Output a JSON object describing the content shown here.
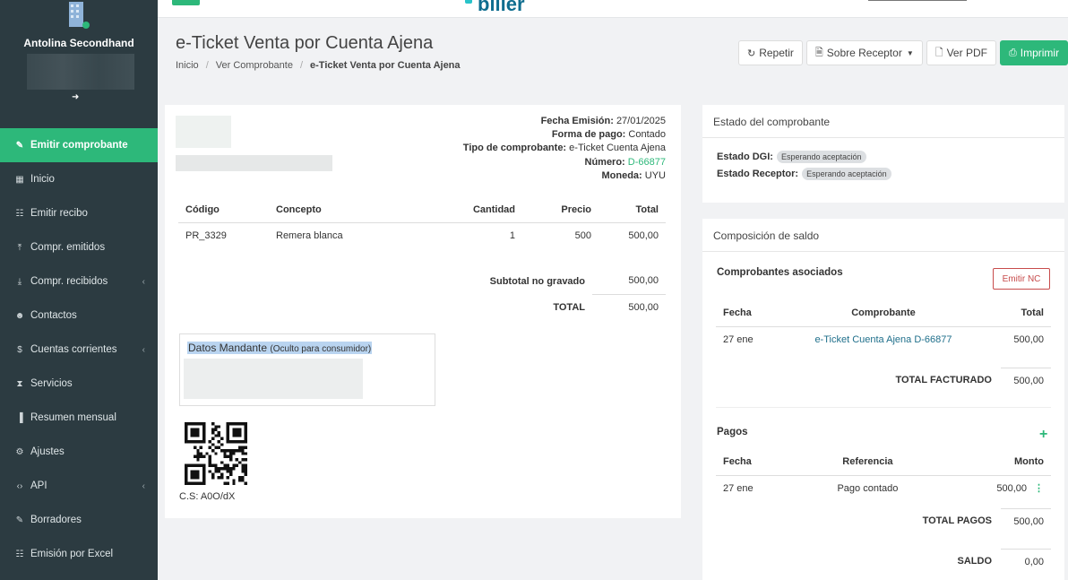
{
  "sidebar": {
    "company": "Antolina Secondhand",
    "items": [
      {
        "label": "Emitir comprobante",
        "icon": "edit-icon"
      },
      {
        "label": "Inicio",
        "icon": "dashboard-icon"
      },
      {
        "label": "Emitir recibo",
        "icon": "document-icon"
      },
      {
        "label": "Compr. emitidos",
        "icon": "upload-icon"
      },
      {
        "label": "Compr. recibidos",
        "icon": "download-icon"
      },
      {
        "label": "Contactos",
        "icon": "users-icon"
      },
      {
        "label": "Cuentas corrientes",
        "icon": "dollar-icon"
      },
      {
        "label": "Servicios",
        "icon": "hourglass-icon"
      },
      {
        "label": "Resumen mensual",
        "icon": "bar-chart-icon"
      },
      {
        "label": "Ajustes",
        "icon": "gears-icon"
      },
      {
        "label": "API",
        "icon": "code-icon"
      },
      {
        "label": "Borradores",
        "icon": "pencil-icon"
      },
      {
        "label": "Emisión por Excel",
        "icon": "document-icon"
      }
    ]
  },
  "topbar": {
    "logo": "biller"
  },
  "header": {
    "title": "e-Ticket Venta por Cuenta Ajena",
    "breadcrumb": [
      "Inicio",
      "Ver Comprobante",
      "e-Ticket Venta por Cuenta Ajena"
    ],
    "buttons": {
      "repetir": "Repetir",
      "receptor": "Sobre Receptor",
      "pdf": "Ver PDF",
      "imprimir": "Imprimir"
    }
  },
  "invoice": {
    "meta": [
      {
        "label": "Fecha Emisión:",
        "value": "27/01/2025"
      },
      {
        "label": "Forma de pago:",
        "value": "Contado"
      },
      {
        "label": "Tipo de comprobante:",
        "value": "e-Ticket Cuenta Ajena"
      },
      {
        "label": "Número:",
        "value": "D-66877"
      },
      {
        "label": "Moneda:",
        "value": "UYU"
      }
    ],
    "columns": [
      "Código",
      "Concepto",
      "Cantidad",
      "Precio",
      "Total"
    ],
    "rows": [
      {
        "codigo": "PR_3329",
        "concepto": "Remera blanca",
        "cantidad": "1",
        "precio": "500",
        "total": "500,00"
      }
    ],
    "subtotal_label": "Subtotal no gravado",
    "subtotal_value": "500,00",
    "total_label": "TOTAL",
    "total_value": "500,00",
    "mandante_title": "Datos Mandante",
    "mandante_note": "(Oculto para consumidor)",
    "cs": "C.S: A0O/dX"
  },
  "estado": {
    "title": "Estado del comprobante",
    "dgi_label": "Estado DGI:",
    "dgi_value": "Esperando aceptación",
    "receptor_label": "Estado Receptor:",
    "receptor_value": "Esperando aceptación"
  },
  "saldo": {
    "title": "Composición de saldo",
    "asociados_title": "Comprobantes asociados",
    "emitir_nc": "Emitir NC",
    "asociados_columns": [
      "Fecha",
      "Comprobante",
      "Total"
    ],
    "asociados_rows": [
      {
        "fecha": "27 ene",
        "comprobante": "e-Ticket Cuenta Ajena D-66877",
        "total": "500,00"
      }
    ],
    "total_facturado_label": "TOTAL FACTURADO",
    "total_facturado_value": "500,00",
    "pagos_title": "Pagos",
    "pagos_columns": [
      "Fecha",
      "Referencia",
      "Monto"
    ],
    "pagos_rows": [
      {
        "fecha": "27 ene",
        "referencia": "Pago contado",
        "monto": "500,00"
      }
    ],
    "total_pagos_label": "TOTAL PAGOS",
    "total_pagos_value": "500,00",
    "saldo_label": "SALDO",
    "saldo_value": "0,00"
  },
  "colors": {
    "accent": "#2db87a",
    "sidebar": "#2c3b41",
    "danger": "#c74b4b",
    "link": "#1f6f8b"
  }
}
